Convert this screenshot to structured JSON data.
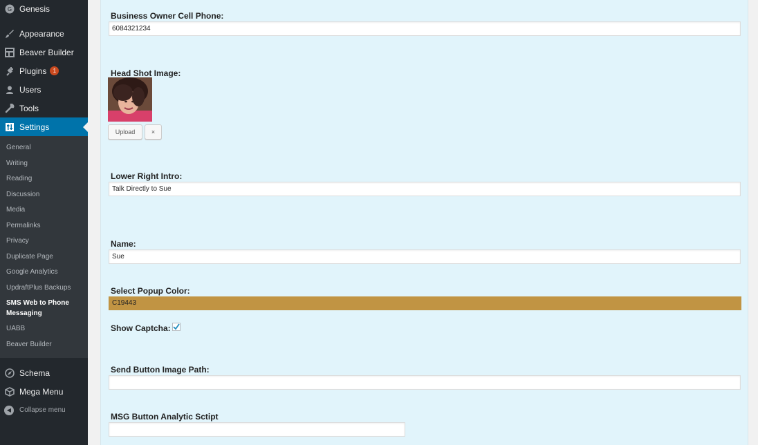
{
  "sidebar": {
    "top_items": [
      {
        "label": "Genesis",
        "icon": "genesis-icon"
      },
      {
        "label": "Appearance",
        "icon": "paintbrush-icon"
      },
      {
        "label": "Beaver Builder",
        "icon": "grid-icon"
      },
      {
        "label": "Plugins",
        "icon": "plug-icon",
        "badge": "1"
      },
      {
        "label": "Users",
        "icon": "user-icon"
      },
      {
        "label": "Tools",
        "icon": "wrench-icon"
      },
      {
        "label": "Settings",
        "icon": "settings-icon"
      }
    ],
    "submenu": [
      "General",
      "Writing",
      "Reading",
      "Discussion",
      "Media",
      "Permalinks",
      "Privacy",
      "Duplicate Page",
      "Google Analytics",
      "UpdraftPlus Backups",
      "SMS Web to Phone Messaging",
      "UABB",
      "Beaver Builder"
    ],
    "bottom_items": [
      {
        "label": "Schema",
        "icon": "compass-icon"
      },
      {
        "label": "Mega Menu",
        "icon": "cube-icon"
      }
    ],
    "collapse_label": "Collapse menu"
  },
  "form": {
    "cell_phone_label": "Business Owner Cell Phone:",
    "cell_phone_value": "6084321234",
    "headshot_label": "Head Shot Image:",
    "upload_label": "Upload",
    "remove_label": "×",
    "intro_label": "Lower Right Intro:",
    "intro_value": "Talk Directly to Sue",
    "name_label": "Name:",
    "name_value": "Sue",
    "popup_color_label": "Select Popup Color:",
    "popup_color_value": "C19443",
    "captcha_label": "Show Captcha:",
    "send_button_label": "Send Button Image Path:",
    "send_button_value": "",
    "msg_analytic_label": "MSG Button Analytic Sctipt",
    "msg_analytic_value": ""
  },
  "colors": {
    "sidebar_bg": "#23282d",
    "active_blue": "#0073aa",
    "content_bg": "#e1f4fb",
    "popup_color": "#c19443"
  }
}
